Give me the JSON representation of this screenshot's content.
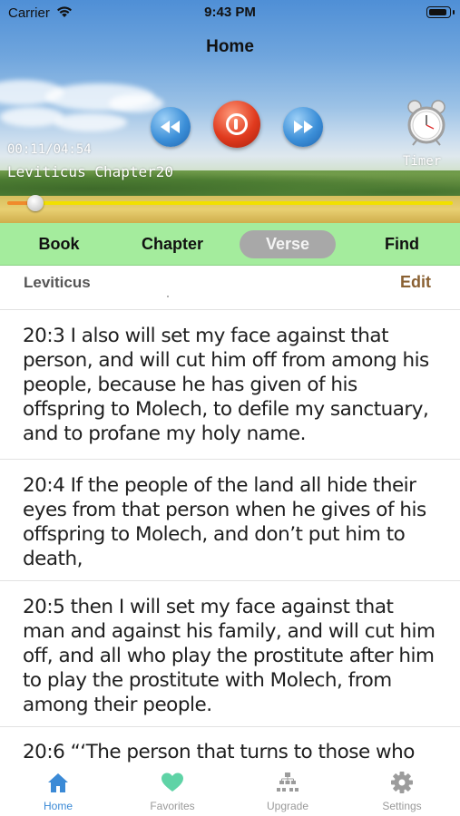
{
  "status_bar": {
    "carrier": "Carrier",
    "time": "9:43 PM"
  },
  "nav": {
    "title": "Home"
  },
  "player": {
    "elapsed": "00:11/04:54",
    "track": "Leviticus Chapter20",
    "timer_label": "Timer",
    "progress": 0.063,
    "colors": {
      "track": "#f1e000",
      "fill": "#f08a2c"
    }
  },
  "mode_tabs": {
    "items": [
      "Book",
      "Chapter",
      "Verse",
      "Find"
    ],
    "selected": "Verse",
    "background": "#a4ec9d"
  },
  "book_row": {
    "book": "Leviticus",
    "edit_label": "Edit"
  },
  "verses": [
    {
      "text": "20:3 I also will set my face against that person, and will cut him off from among his people, because he has given of his offspring to Molech, to defile my sanctuary, and to profane my holy name."
    },
    {
      "text": "20:4 If the people of the land all hide their eyes from that person when he gives of his offspring to Molech, and don’t put him to death,"
    },
    {
      "text": "20:5 then I will set my face against that man and against his family, and will cut him off, and all who play the prostitute after him to play the prostitute with Molech, from among their people."
    },
    {
      "text": "20:6 “‘The person that turns to those who"
    }
  ],
  "tab_bar": {
    "items": [
      {
        "label": "Home",
        "icon": "house-icon"
      },
      {
        "label": "Favorites",
        "icon": "heart-icon"
      },
      {
        "label": "Upgrade",
        "icon": "upgrade-icon"
      },
      {
        "label": "Settings",
        "icon": "gear-icon"
      }
    ],
    "selected": "Home",
    "accent": "#3b8ad6"
  }
}
